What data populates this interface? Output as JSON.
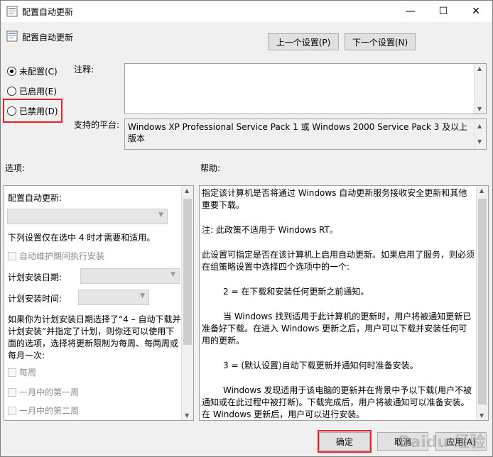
{
  "window": {
    "title": "配置自动更新",
    "controls": {
      "minimize": "—",
      "maximize": "☐",
      "close": "✕"
    }
  },
  "header": {
    "title": "配置自动更新",
    "prev_button": "上一个设置(P)",
    "next_button": "下一个设置(N)"
  },
  "state": {
    "options": [
      {
        "label": "未配置(C)",
        "checked": true
      },
      {
        "label": "已启用(E)",
        "checked": false
      },
      {
        "label": "已禁用(D)",
        "checked": false
      }
    ]
  },
  "comment": {
    "label": "注释:",
    "value": ""
  },
  "platform": {
    "label": "支持的平台:",
    "value": "Windows XP Professional Service Pack 1 或 Windows 2000 Service Pack 3 及以上版本"
  },
  "options_panel": {
    "label": "选项:",
    "configure_label": "配置自动更新:",
    "note": "下列设置仅在选中 4 时才需要和适用。",
    "maintenance_checkbox": "自动维护期间执行安装",
    "schedule_day_label": "计划安装日期:",
    "schedule_time_label": "计划安装时间:",
    "para": "如果你为计划安装日期选择了“4 – 自动下载并计划安装”并指定了计划，则你还可以使用下面的选项，选择将更新限制为每周、每两周或每月一次:",
    "checkboxes": [
      "每周",
      "一月中的第一周",
      "一月中的第二周"
    ]
  },
  "help_panel": {
    "label": "帮助:",
    "paragraphs": [
      "指定该计算机是否将通过 Windows 自动更新服务接收安全更新和其他重要下载。",
      "注: 此政策不适用于 Windows RT。",
      "此设置可指定是否在该计算机上启用自动更新。如果启用了服务，则必须在组策略设置中选择四个选项中的一个:",
      "2 = 在下载和安装任何更新之前通知。",
      "当 Windows 找到适用于此计算机的更新时，用户将被通知更新已准备好下载。在进入 Windows 更新之后，用户可以下载并安装任何可用的更新。",
      "3 = (默认设置)自动下载更新并通知何时准备安装。",
      "Windows 发现适用于该电脑的更新并在背景中予以下载(用户不被通知或在此过程中被打断)。下载完成后，用户将被通知可以准备安装。在 Windows 更新后，用户可以进行安装。"
    ]
  },
  "footer": {
    "ok": "确定",
    "cancel": "取消",
    "apply": "应用(A)"
  },
  "watermark": "Baidu 经验"
}
